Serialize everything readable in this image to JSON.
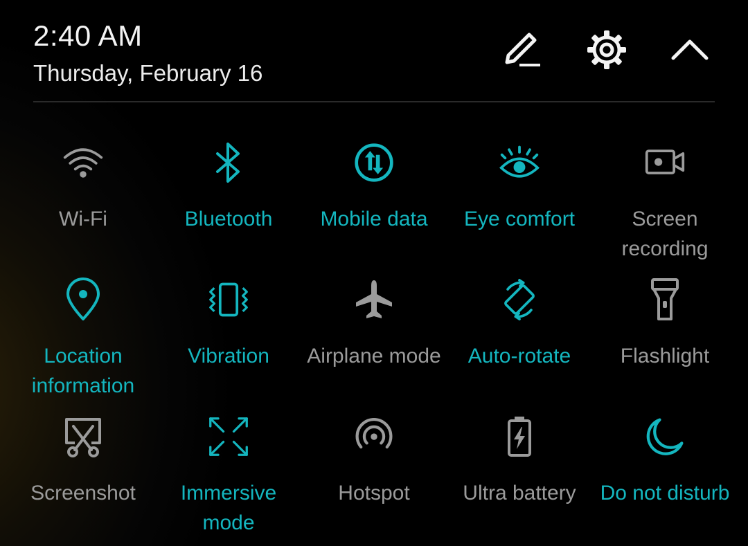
{
  "status": {
    "time": "2:40 AM",
    "date": "Thursday, February 16"
  },
  "header_actions": [
    {
      "name": "edit-icon"
    },
    {
      "name": "settings-icon"
    },
    {
      "name": "collapse-icon"
    }
  ],
  "colors": {
    "active": "#14b6bf",
    "inactive": "#9b9b9b",
    "background": "#000000",
    "text": "#f4f4f4"
  },
  "tiles": [
    {
      "label": "Wi-Fi",
      "icon": "wifi-icon",
      "state": "off"
    },
    {
      "label": "Bluetooth",
      "icon": "bluetooth-icon",
      "state": "on"
    },
    {
      "label": "Mobile data",
      "icon": "mobile-data-icon",
      "state": "on"
    },
    {
      "label": "Eye comfort",
      "icon": "eye-icon",
      "state": "on"
    },
    {
      "label": "Screen recording",
      "icon": "screen-recording-icon",
      "state": "off"
    },
    {
      "label": "Location information",
      "icon": "location-pin-icon",
      "state": "on"
    },
    {
      "label": "Vibration",
      "icon": "vibration-icon",
      "state": "on"
    },
    {
      "label": "Airplane mode",
      "icon": "airplane-icon",
      "state": "off"
    },
    {
      "label": "Auto-rotate",
      "icon": "auto-rotate-icon",
      "state": "on"
    },
    {
      "label": "Flashlight",
      "icon": "flashlight-icon",
      "state": "off"
    },
    {
      "label": "Screenshot",
      "icon": "screenshot-icon",
      "state": "off"
    },
    {
      "label": "Immersive mode",
      "icon": "immersive-mode-icon",
      "state": "on"
    },
    {
      "label": "Hotspot",
      "icon": "hotspot-icon",
      "state": "off"
    },
    {
      "label": "Ultra battery",
      "icon": "battery-icon",
      "state": "off"
    },
    {
      "label": "Do not disturb",
      "icon": "moon-icon",
      "state": "on"
    }
  ]
}
